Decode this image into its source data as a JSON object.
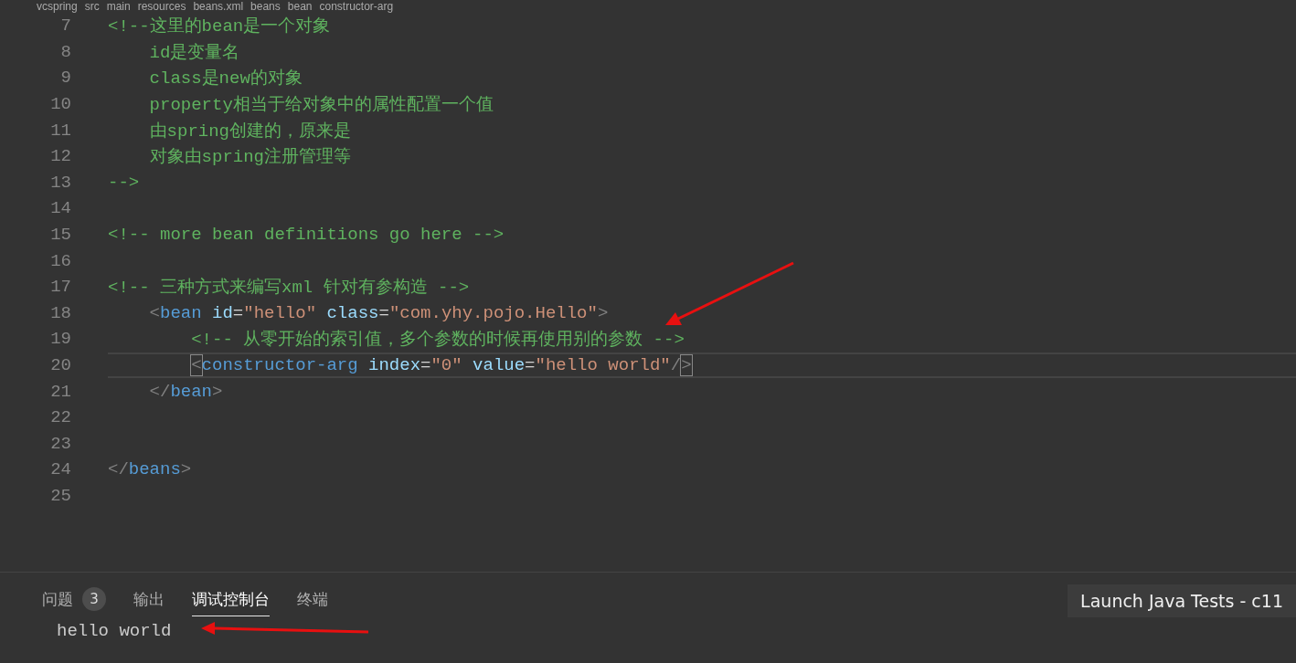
{
  "breadcrumb": [
    "vcspring",
    "src",
    "main",
    "resources",
    "beans.xml",
    "beans",
    "bean",
    "constructor-arg"
  ],
  "code_lines": [
    {
      "number": "7",
      "current": false,
      "tokens": [
        {
          "kind": "comment",
          "text": "<!--这里的bean是一个对象"
        }
      ],
      "children": [
        {
          "number": "8",
          "current": false,
          "tokens": [
            {
              "kind": "comment",
              "text": "id是变量名"
            }
          ]
        },
        {
          "number": "9",
          "current": false,
          "tokens": [
            {
              "kind": "comment",
              "text": "class是new的对象"
            }
          ]
        },
        {
          "number": "10",
          "current": false,
          "tokens": [
            {
              "kind": "comment",
              "text": "property相当于给对象中的属性配置一个值"
            }
          ]
        },
        {
          "number": "11",
          "current": false,
          "tokens": [
            {
              "kind": "comment",
              "text": "由spring创建的，原来是"
            }
          ]
        },
        {
          "number": "12",
          "current": false,
          "tokens": [
            {
              "kind": "comment",
              "text": "对象由spring注册管理等"
            }
          ]
        }
      ]
    },
    {
      "number": "13",
      "current": false,
      "tokens": [
        {
          "kind": "comment",
          "text": "-->"
        }
      ]
    },
    {
      "number": "14",
      "current": false
    },
    {
      "number": "15",
      "current": false,
      "tokens": [
        {
          "kind": "comment",
          "text": "<!-- more bean definitions go here -->"
        }
      ]
    },
    {
      "number": "16",
      "current": false
    },
    {
      "number": "17",
      "current": false,
      "tokens": [
        {
          "kind": "comment",
          "text": "<!-- 三种方式来编写xml 针对有参构造 -->"
        }
      ],
      "children": [
        {
          "number": "18",
          "current": false,
          "tokens": [
            {
              "kind": "bracket",
              "text": "<"
            },
            {
              "kind": "tag",
              "text": "bean"
            },
            {
              "kind": "attr",
              "text": " id"
            },
            {
              "kind": "eq",
              "text": "="
            },
            {
              "kind": "string",
              "text": "\"hello\""
            },
            {
              "kind": "attr",
              "text": " class"
            },
            {
              "kind": "eq",
              "text": "="
            },
            {
              "kind": "string",
              "text": "\"com.yhy.pojo.Hello\""
            },
            {
              "kind": "bracket",
              "text": ">"
            }
          ],
          "children": [
            {
              "number": "19",
              "current": false,
              "tokens": [
                {
                  "kind": "comment",
                  "text": "<!-- 从零开始的索引值，多个参数的时候再使用别的参数 -->"
                }
              ]
            },
            {
              "number": "20",
              "current": true,
              "tokens": [
                {
                  "kind": "bracket-match",
                  "text": "<"
                },
                {
                  "kind": "tag",
                  "text": "constructor-arg"
                },
                {
                  "kind": "attr",
                  "text": " index"
                },
                {
                  "kind": "eq",
                  "text": "="
                },
                {
                  "kind": "string",
                  "text": "\"0\""
                },
                {
                  "kind": "attr",
                  "text": " value"
                },
                {
                  "kind": "eq",
                  "text": "="
                },
                {
                  "kind": "string",
                  "text": "\"hello world\""
                },
                {
                  "kind": "bracket",
                  "text": "/"
                },
                {
                  "kind": "bracket-match",
                  "text": ">"
                }
              ]
            }
          ]
        },
        {
          "number": "21",
          "current": false,
          "tokens": [
            {
              "kind": "bracket",
              "text": "</"
            },
            {
              "kind": "tag",
              "text": "bean"
            },
            {
              "kind": "bracket",
              "text": ">"
            }
          ]
        },
        {
          "number": "22",
          "current": false
        },
        {
          "number": "23",
          "current": false
        }
      ]
    },
    {
      "number": "24",
      "current": false,
      "tokens": [
        {
          "kind": "bracket",
          "text": "</"
        },
        {
          "kind": "tag",
          "text": "beans"
        },
        {
          "kind": "bracket",
          "text": ">"
        }
      ]
    },
    {
      "number": "25",
      "current": false
    }
  ],
  "panel": {
    "tabs": [
      {
        "label": "问题",
        "badge": "3",
        "selected": false
      },
      {
        "label": "输出",
        "selected": false
      },
      {
        "label": "调试控制台",
        "selected": true
      },
      {
        "label": "终端",
        "selected": false
      }
    ],
    "launch_config": "Launch Java Tests - c11",
    "output": "hello world"
  }
}
